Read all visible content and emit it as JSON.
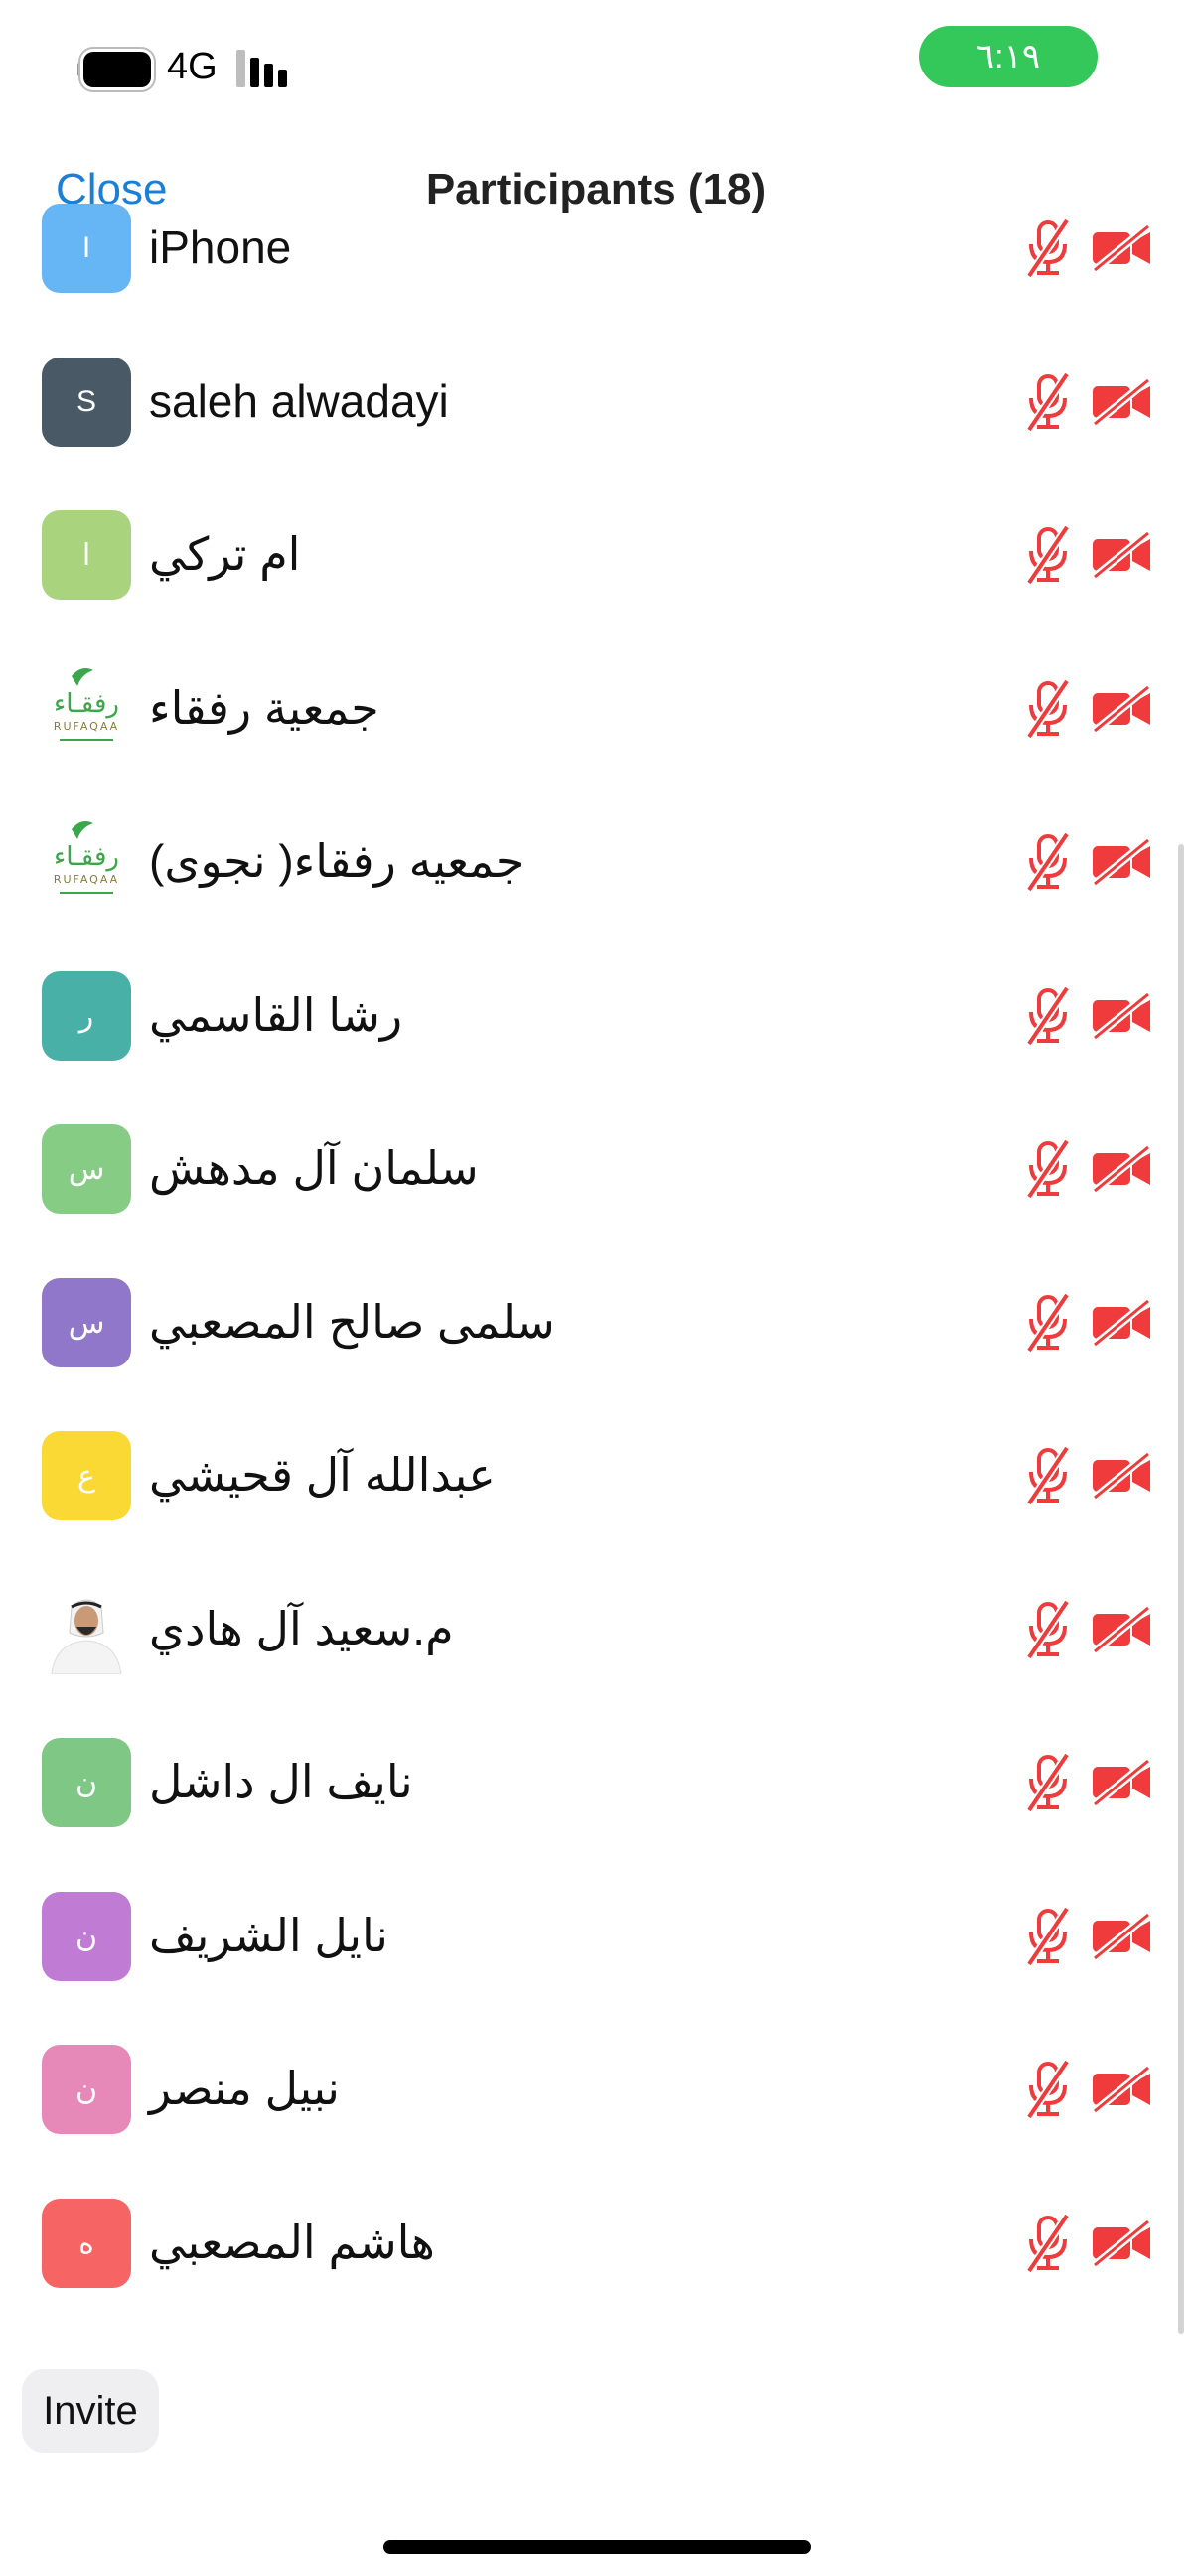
{
  "status_bar": {
    "network": "4G",
    "time": "٦:١٩",
    "battery_level": 1.0,
    "signal_bars_active": 3
  },
  "header": {
    "close_label": "Close",
    "title": "Participants (18)"
  },
  "participants": [
    {
      "name": "iPhone",
      "initial": "I",
      "avatar_color": "#66b6f5",
      "avatar_type": "initial",
      "mic_muted": true,
      "video_off": true
    },
    {
      "name": "saleh alwadayi",
      "initial": "S",
      "avatar_color": "#495a66",
      "avatar_type": "initial",
      "mic_muted": true,
      "video_off": true
    },
    {
      "name": "ام تركي",
      "initial": "ا",
      "avatar_color": "#a9d47d",
      "avatar_type": "initial",
      "mic_muted": true,
      "video_off": true
    },
    {
      "name": "جمعية رفقاء",
      "initial": "",
      "avatar_color": "#ffffff",
      "avatar_type": "logo",
      "mic_muted": true,
      "video_off": true
    },
    {
      "name": "جمعيه رفقاء( نجوى)",
      "initial": "",
      "avatar_color": "#ffffff",
      "avatar_type": "logo",
      "mic_muted": true,
      "video_off": true
    },
    {
      "name": "رشا القاسمي",
      "initial": "ر",
      "avatar_color": "#49b0a8",
      "avatar_type": "initial",
      "mic_muted": true,
      "video_off": true
    },
    {
      "name": "سلمان آل مدهش",
      "initial": "س",
      "avatar_color": "#86cc84",
      "avatar_type": "initial",
      "mic_muted": true,
      "video_off": true
    },
    {
      "name": "سلمى صالح المصعبي",
      "initial": "س",
      "avatar_color": "#9077c9",
      "avatar_type": "initial",
      "mic_muted": true,
      "video_off": true
    },
    {
      "name": "عبدالله آل قحيشي",
      "initial": "ع",
      "avatar_color": "#fbd935",
      "avatar_type": "initial",
      "mic_muted": true,
      "video_off": true
    },
    {
      "name": "م.سعيد آل هادي",
      "initial": "",
      "avatar_color": "#ffffff",
      "avatar_type": "photo",
      "mic_muted": true,
      "video_off": true
    },
    {
      "name": "نايف ال داشل",
      "initial": "ن",
      "avatar_color": "#7fc785",
      "avatar_type": "initial",
      "mic_muted": true,
      "video_off": true
    },
    {
      "name": "نايل الشريف",
      "initial": "ن",
      "avatar_color": "#c07bd5",
      "avatar_type": "initial",
      "mic_muted": true,
      "video_off": true
    },
    {
      "name": "نبيل منصر",
      "initial": "ن",
      "avatar_color": "#e689b9",
      "avatar_type": "initial",
      "mic_muted": true,
      "video_off": true
    },
    {
      "name": "هاشم المصعبي",
      "initial": "ه",
      "avatar_color": "#f76464",
      "avatar_type": "initial",
      "mic_muted": true,
      "video_off": true
    }
  ],
  "logo_text": {
    "arabic": "رفقـاء",
    "latin": "RUFAQAA"
  },
  "icons": {
    "mic": "mic-muted-icon",
    "camera": "video-off-icon",
    "muted_color": "#ef3b3b"
  },
  "footer": {
    "invite_label": "Invite"
  }
}
